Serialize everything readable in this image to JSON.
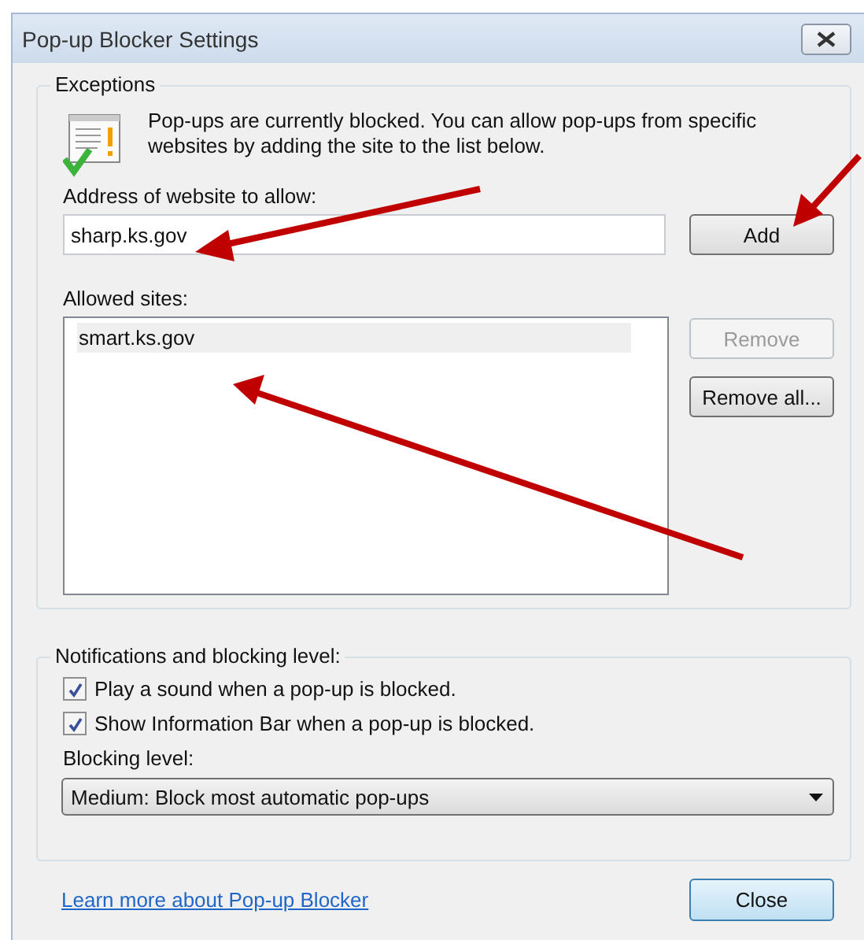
{
  "window": {
    "title": "Pop-up Blocker Settings"
  },
  "exceptions": {
    "legend": "Exceptions",
    "message": "Pop-ups are currently blocked.  You can allow pop-ups from specific websites by adding the site to the list below.",
    "address_label": "Address of website to allow:",
    "address_value": "sharp.ks.gov",
    "add_button": {
      "label": "Add",
      "disabled": false
    },
    "allowed_label": "Allowed sites:",
    "sites": [
      {
        "label": "smart.ks.gov",
        "selected": true
      }
    ],
    "buttons": [
      {
        "label": "Remove",
        "disabled": true
      },
      {
        "label": "Remove all...",
        "disabled": false
      }
    ]
  },
  "notifications": {
    "legend": "Notifications and blocking level:",
    "options": [
      {
        "label": "Play a sound when a pop-up is blocked.",
        "checked": true
      },
      {
        "label": "Show Information Bar when a pop-up is blocked.",
        "checked": true
      }
    ],
    "blocking_label": "Blocking level:",
    "blocking_value": "Medium: Block most automatic pop-ups"
  },
  "footer": {
    "link": "Learn more about Pop-up Blocker",
    "close_button": "Close"
  }
}
